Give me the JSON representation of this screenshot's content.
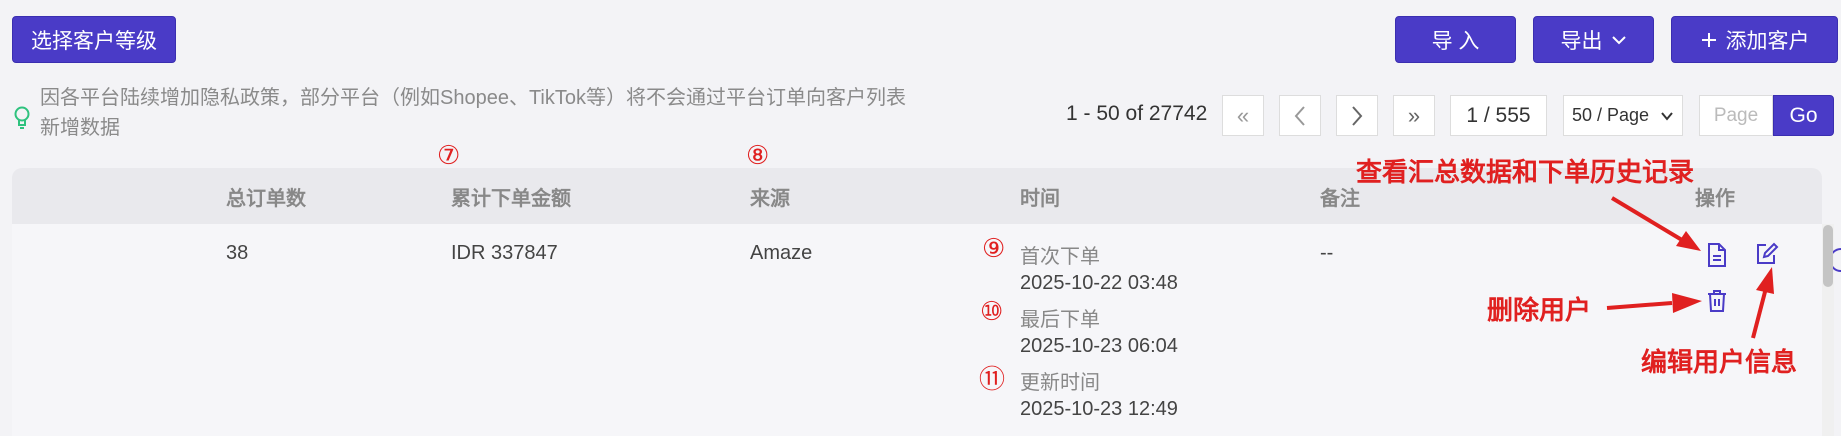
{
  "toolbar": {
    "select_level": "选择客户等级",
    "import": "导 入",
    "export": "导出",
    "add_customer": "添加客户"
  },
  "notice": {
    "text": "因各平台陆续增加隐私政策，部分平台（例如Shopee、TikTok等）将不会通过平台订单向客户列表新增数据",
    "icon": "lightbulb-icon"
  },
  "pagination": {
    "summary": "1 - 50 of 27742",
    "first": "«",
    "prev": "‹",
    "next": "›",
    "last": "»",
    "page_display": "1 / 555",
    "page_size": "50 / Page",
    "page_input_placeholder": "Page",
    "go": "Go"
  },
  "table": {
    "headers": {
      "total_orders": "总订单数",
      "total_amount": "累计下单金额",
      "source": "来源",
      "time": "时间",
      "note": "备注",
      "actions": "操作"
    },
    "rows": [
      {
        "total_orders": "38",
        "total_amount": "IDR 337847",
        "source": "Amaze",
        "first_order_label": "首次下单",
        "first_order_time": "2025-10-22 03:48",
        "last_order_label": "最后下单",
        "last_order_time": "2025-10-23 06:04",
        "updated_label": "更新时间",
        "updated_time": "2025-10-23 12:49",
        "note": "--"
      }
    ]
  },
  "annotations": {
    "c7": "⑦",
    "c8": "⑧",
    "c9": "⑨",
    "c10": "⑩",
    "c11": "⑪",
    "view_summary": "查看汇总数据和下单历史记录",
    "delete_user": "删除用户",
    "edit_user": "编辑用户信息"
  },
  "colors": {
    "primary": "#4a3bc7",
    "annotation": "#e02020",
    "notice_icon": "#2ec27e"
  }
}
